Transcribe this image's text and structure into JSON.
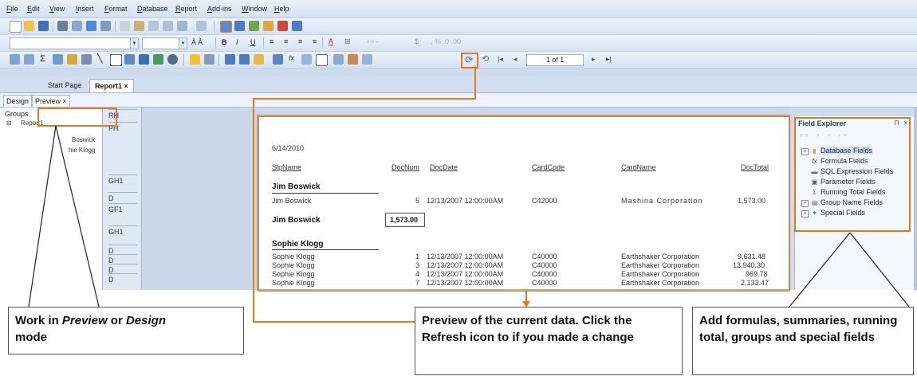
{
  "menu": [
    "File",
    "Edit",
    "View",
    "Insert",
    "Format",
    "Database",
    "Report",
    "Add-ins",
    "Window",
    "Help"
  ],
  "toolbar": {
    "fontsize_combo": "",
    "page_indicator": "1 of 1"
  },
  "tabs": [
    "Start Page",
    "Report1 ×"
  ],
  "modes": [
    "Design",
    "Preview ×"
  ],
  "groups_panel": {
    "title": "Groups",
    "root": "Report1",
    "items": [
      "Boswick",
      "hie Klogg"
    ]
  },
  "design_strip": {
    "sections": [
      "RH",
      "PH",
      "GH1",
      "D",
      "GF1",
      "GH1",
      "D",
      "D",
      "D",
      "D"
    ]
  },
  "report": {
    "date": "6/14/2010",
    "headers": [
      "SlpName",
      "DocNum",
      "DocDate",
      "CardCode",
      "CardName",
      "DocTotal"
    ],
    "group1": {
      "name": "Jim Boswick",
      "rows": [
        {
          "slp": "Jim Boswick",
          "num": "5",
          "date": "12/13/2007  12:00:00AM",
          "code": "C42000",
          "name": "Mashina Corporation",
          "total": "1,573.00"
        }
      ],
      "footer_name": "Jim Boswick",
      "footer_total": "1,573.00"
    },
    "group2": {
      "name": "Sophie Klogg",
      "rows": [
        {
          "slp": "Sophie Klogg",
          "num": "1",
          "date": "12/13/2007  12:00:00AM",
          "code": "C40000",
          "name": "Earthshaker Corporation",
          "total": "9,631.48"
        },
        {
          "slp": "Sophie Klogg",
          "num": "3",
          "date": "12/13/2007  12:00:00AM",
          "code": "C40000",
          "name": "Earthshaker Corporation",
          "total": "13,940.30"
        },
        {
          "slp": "Sophie Klogg",
          "num": "4",
          "date": "12/13/2007  12:00:00AM",
          "code": "C40000",
          "name": "Earthshaker Corporation",
          "total": "969.78"
        },
        {
          "slp": "Sophie Klogg",
          "num": "7",
          "date": "12/13/2007  12:00:00AM",
          "code": "C40000",
          "name": "Earthshaker Corporation",
          "total": "2,133.47"
        }
      ]
    }
  },
  "field_explorer": {
    "title": "Field Explorer",
    "items": [
      "Database Fields",
      "Formula Fields",
      "SQL Expression Fields",
      "Parameter Fields",
      "Running Total Fields",
      "Group Name Fields",
      "Special Fields"
    ]
  },
  "callouts": {
    "design_prefix": "Work in ",
    "design_em1": "Preview",
    "design_mid": " or ",
    "design_em2": "Design",
    "design_suffix": "mode",
    "preview": "Preview of the current data. Click the Refresh icon to if you made a change",
    "fields": "Add formulas, summaries, running total, groups and special fields"
  },
  "colors": {
    "accent": "#e07b1e",
    "ui_blue": "#cfdcee"
  }
}
